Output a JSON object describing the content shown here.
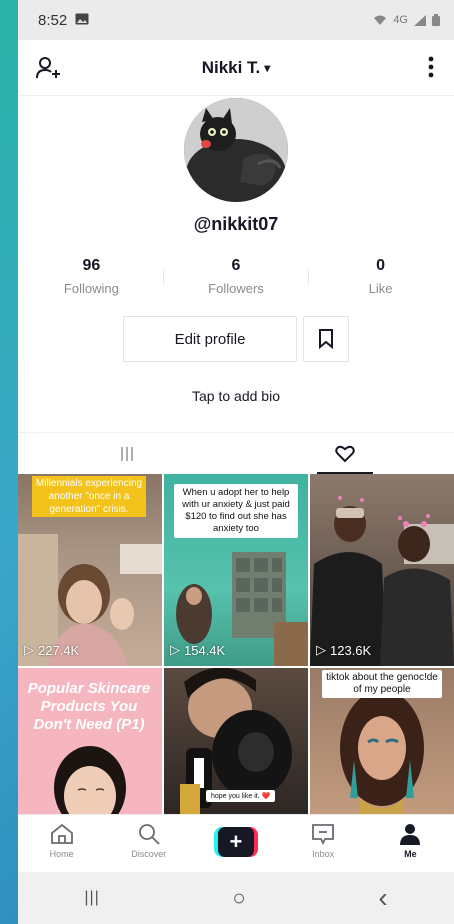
{
  "status_bar": {
    "time": "8:52",
    "right_text": "4G"
  },
  "header": {
    "username_title": "Nikki T.",
    "dropdown_glyph": "▾"
  },
  "profile": {
    "handle": "@nikkit07",
    "bio_prompt": "Tap to add bio",
    "edit_label": "Edit profile"
  },
  "stats": [
    {
      "value": "96",
      "label": "Following"
    },
    {
      "value": "6",
      "label": "Followers"
    },
    {
      "value": "0",
      "label": "Like"
    }
  ],
  "tabs": [
    {
      "icon": "grid-icon",
      "active": false
    },
    {
      "icon": "heart-icon",
      "active": true
    }
  ],
  "videos": [
    {
      "views": "227.4K",
      "caption": "Millennials experiencing another \"once in a generation\" crisis.",
      "caption_style": "yellow",
      "bg": "#b39b86"
    },
    {
      "views": "154.4K",
      "caption": "When u adopt her to help with ur anxiety & just paid $120 to find out she has anxiety too",
      "caption_style": "white",
      "bg": "#4fb9a6"
    },
    {
      "views": "123.6K",
      "caption": "",
      "caption_style": "none",
      "bg": "#5c4d45"
    },
    {
      "views": "",
      "caption": "Popular Skincare Products You Don't Need (P1)",
      "caption_style": "pink",
      "bg": "#f7b8c1"
    },
    {
      "views": "",
      "caption": "hope you like it. ❤️",
      "caption_style": "small",
      "bg": "#3a3530"
    },
    {
      "views": "",
      "caption": "tiktok about the genoc!de of my people",
      "caption_style": "white-top",
      "bg": "#b08468"
    }
  ],
  "bottom_nav": [
    {
      "label": "Home",
      "icon": "home-icon",
      "active": false
    },
    {
      "label": "Discover",
      "icon": "search-icon",
      "active": false
    },
    {
      "label": "",
      "icon": "create-plus-icon",
      "active": false,
      "plus": "+"
    },
    {
      "label": "Inbox",
      "icon": "inbox-icon",
      "active": false
    },
    {
      "label": "Me",
      "icon": "profile-icon",
      "active": true
    }
  ],
  "system_nav": {
    "recents": "|||",
    "home": "○",
    "back": "‹"
  },
  "colors": {
    "accent_pink": "#fe2c55",
    "accent_cyan": "#25f4ee",
    "text": "#161823",
    "muted": "#8a8b91"
  }
}
